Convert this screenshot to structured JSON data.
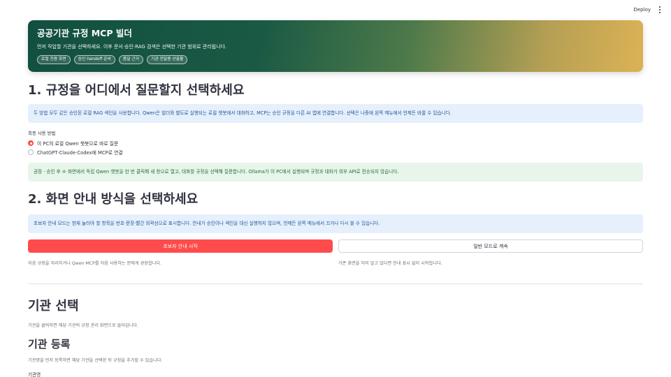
{
  "topbar": {
    "deploy_label": "Deploy"
  },
  "hero": {
    "title": "공공기관 규정 MCP 빌더",
    "subtitle": "먼저 작업할 기관을 선택하세요. 이후 문서·승인·RAG 검색은 선택한 기관 범위로 관리됩니다.",
    "chips": [
      "로컬 전용 화면",
      "승인 handoff 준비",
      "품질 근거",
      "기관 전달용 산출물"
    ]
  },
  "section1": {
    "heading": "1. 규정을 어디에서 질문할지 선택하세요",
    "info": "두 방법 모두 같은 승인된 로컬 RAG 색인을 사용합니다. Qwen은 빌더와 별도로 실행되는 로컬 챗봇에서 대화하고, MCP는 승인 규정을 다른 AI 앱에 연결합니다. 선택은 나중에 왼쪽 메뉴에서 언제든 바꿀 수 있습니다.",
    "radio_label": "최종 사용 방법",
    "options": [
      {
        "label": "이 PC의 로컬 Qwen 챗봇으로 바로 질문",
        "selected": true
      },
      {
        "label": "ChatGPT·Claude·Codex에 MCP로 연결",
        "selected": false
      }
    ],
    "success": "권장 · 승인 후 ④ 화면에서 독립 Qwen 챗봇을 한 번 클릭해 새 창으로 열고, 대화할 규정을 선택해 질문합니다. Ollama가 이 PC에서 실행되며 규정과 대화가 외부 API로 전송되지 않습니다."
  },
  "section2": {
    "heading": "2. 화면 안내 방식을 선택하세요",
    "info": "초보자 안내 모드는 현재 눌러야 할 항목을 번호·문장·빨간 외곽선으로 표시합니다. 안내가 승인이나 색인을 대신 실행하지 않으며, 언제든 왼쪽 메뉴에서 끄거나 다시 볼 수 있습니다.",
    "primary_button": "초보자 안내 시작",
    "secondary_button": "일반 모드로 계속",
    "primary_caption": "처음 규정을 처리하거나 Qwen·MCP를 처음 사용하는 분에게 권장합니다.",
    "secondary_caption": "기존 화면을 이미 알고 있다면 안내 표시 없이 시작합니다."
  },
  "agency": {
    "heading": "기관 선택",
    "caption": "기관을 클릭하면 해당 기관의 규정 관리 화면으로 들어갑니다.",
    "register_heading": "기관 등록",
    "register_caption": "기관명을 먼저 등록하면 해당 기관을 선택한 뒤 규정을 추가할 수 있습니다.",
    "field_label": "기관명"
  },
  "colors": {
    "primary": "#ff4b4b",
    "info_bg": "#e6f0fc",
    "success_bg": "#e8f5ea"
  }
}
